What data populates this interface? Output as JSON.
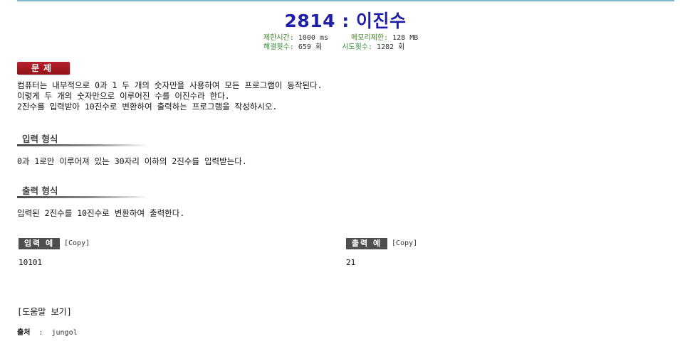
{
  "problem": {
    "title": "2814 : 이진수",
    "stats": {
      "time_label": "제한시간:",
      "time_value": "1000 ms",
      "memory_label": "메모리제한:",
      "memory_value": "128 MB",
      "solved_label": "해결횟수:",
      "solved_value": "659 회",
      "tried_label": "시도횟수:",
      "tried_value": "1282 회"
    },
    "section_badge": "문제",
    "description": [
      "컴퓨터는 내부적으로 0과 1 두 개의 숫자만을 사용하여 모든 프로그램이 동작된다.",
      "이렇게 두 개의 숫자만으로 이루어진 수를 이진수라 한다.",
      "2진수를 입력받아 10진수로 변환하여 출력하는 프로그램을 작성하시오."
    ]
  },
  "input_format": {
    "heading": "입력 형식",
    "text": "0과 1로만 이루어져 있는 30자리 이하의 2진수를 입력받는다."
  },
  "output_format": {
    "heading": "출력 형식",
    "text": "입력된 2진수를 10진수로 변환하여 출력한다."
  },
  "sample_input": {
    "badge": "입력 예",
    "copy": "[Copy]",
    "value": "10101"
  },
  "sample_output": {
    "badge": "출력 예",
    "copy": "[Copy]",
    "value": "21"
  },
  "help_link": "[도움말 보기]",
  "source": {
    "label": "출처",
    "separator": ":",
    "value": "jungol"
  }
}
